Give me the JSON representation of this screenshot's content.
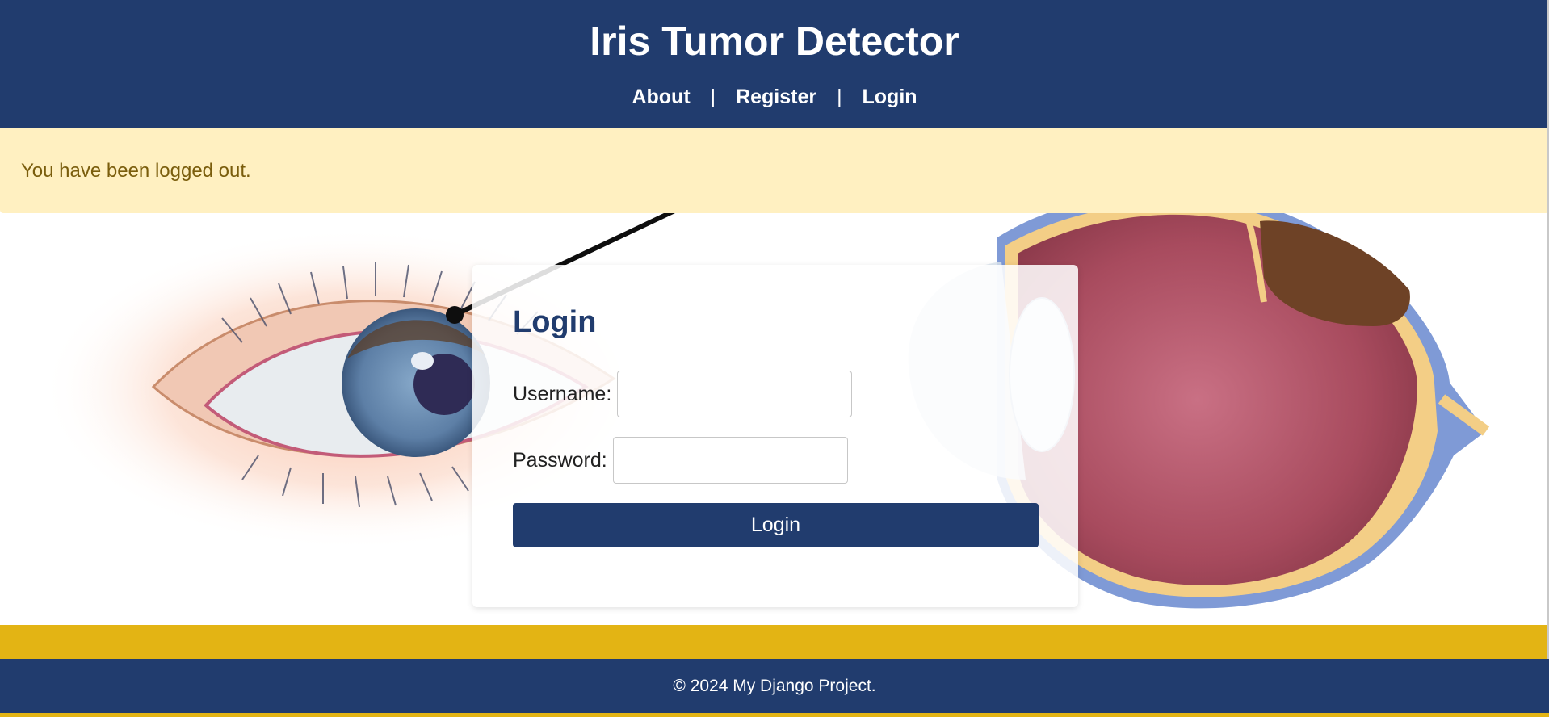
{
  "header": {
    "title": "Iris Tumor Detector",
    "nav": [
      {
        "label": "About"
      },
      {
        "label": "Register"
      },
      {
        "label": "Login"
      }
    ],
    "separator": "|"
  },
  "alert": {
    "message": "You have been logged out."
  },
  "login_form": {
    "heading": "Login",
    "username_label": "Username:",
    "username_value": "",
    "password_label": "Password:",
    "password_value": "",
    "submit_label": "Login"
  },
  "footer": {
    "text": "© 2024 My Django Project."
  },
  "colors": {
    "brand_navy": "#213c6e",
    "accent_gold": "#e3b414",
    "alert_bg": "#fff0c1",
    "alert_text": "#7a5d0c"
  }
}
